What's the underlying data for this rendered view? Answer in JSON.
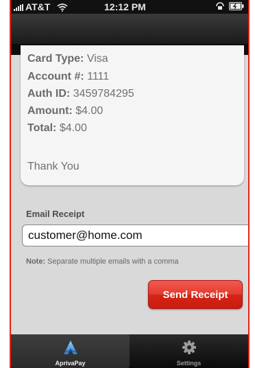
{
  "status_bar": {
    "carrier": "AT&T",
    "time": "12:12 PM"
  },
  "receipt": {
    "card_type_label": "Card Type:",
    "card_type_value": "Visa",
    "account_label": "Account #:",
    "account_value": "1111",
    "auth_label": "Auth ID:",
    "auth_value": "3459784295",
    "amount_label": "Amount:",
    "amount_value": "$4.00",
    "total_label": "Total:",
    "total_value": "$4.00",
    "thank_you": "Thank You"
  },
  "email": {
    "label": "Email Receipt",
    "value": "customer@home.com",
    "note_label": "Note:",
    "note_text": "Separate multiple emails with a comma"
  },
  "actions": {
    "send_label": "Send Receipt"
  },
  "tab_bar": {
    "tabs": [
      {
        "label": "AprivaPay",
        "icon": "apriva-logo-icon",
        "active": true
      },
      {
        "label": "Settings",
        "icon": "gear-icon",
        "active": false
      }
    ]
  },
  "colors": {
    "accent_red": "#e23326",
    "tab_active_icon": "#5aa8f0",
    "bar_dark": "#111111"
  }
}
